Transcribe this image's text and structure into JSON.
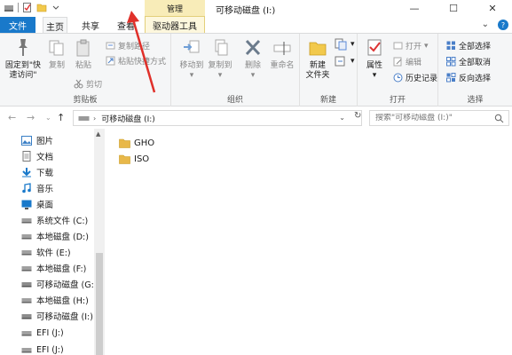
{
  "titlebar": {
    "context_group": "管理",
    "window_title": "可移动磁盘 (I:)",
    "controls": {
      "minimize": "—",
      "maximize": "☐",
      "close": "✕"
    }
  },
  "tabs": {
    "file": "文件",
    "home": "主页",
    "share": "共享",
    "view": "查看",
    "drive_tools": "驱动器工具",
    "expand_icon": "chevron-down-icon",
    "help_icon": "help-icon"
  },
  "ribbon": {
    "clipboard": {
      "label": "剪贴板",
      "pin": "固定到\"快\n速访问\"",
      "copy": "复制",
      "paste": "粘贴",
      "copy_path": "复制路径",
      "paste_shortcut": "粘贴快捷方式",
      "cut": "剪切"
    },
    "organize": {
      "label": "组织",
      "move_to": "移动到",
      "copy_to": "复制到",
      "delete": "删除",
      "rename": "重命名"
    },
    "new": {
      "label": "新建",
      "new_folder": "新建\n文件夹"
    },
    "open": {
      "label": "打开",
      "properties": "属性",
      "open": "打开",
      "edit": "编辑",
      "history": "历史记录"
    },
    "select": {
      "label": "选择",
      "select_all": "全部选择",
      "select_none": "全部取消",
      "invert": "反向选择"
    }
  },
  "address": {
    "path": "可移动磁盘 (I:)",
    "search_placeholder": "搜索\"可移动磁盘 (I:)\""
  },
  "nav": [
    {
      "label": "图片",
      "icon": "pictures-icon"
    },
    {
      "label": "文档",
      "icon": "documents-icon"
    },
    {
      "label": "下载",
      "icon": "downloads-icon"
    },
    {
      "label": "音乐",
      "icon": "music-icon"
    },
    {
      "label": "桌面",
      "icon": "desktop-icon"
    },
    {
      "label": "系统文件 (C:)",
      "icon": "drive-icon"
    },
    {
      "label": "本地磁盘 (D:)",
      "icon": "drive-icon"
    },
    {
      "label": "软件 (E:)",
      "icon": "drive-icon"
    },
    {
      "label": "本地磁盘 (F:)",
      "icon": "drive-icon"
    },
    {
      "label": "可移动磁盘 (G:)",
      "icon": "usb-drive-icon"
    },
    {
      "label": "本地磁盘 (H:)",
      "icon": "drive-icon"
    },
    {
      "label": "可移动磁盘 (I:)",
      "icon": "usb-drive-icon"
    },
    {
      "label": "EFI (J:)",
      "icon": "drive-icon"
    },
    {
      "label": "EFI (J:)",
      "icon": "drive-icon"
    }
  ],
  "files": [
    {
      "name": "GHO",
      "icon": "folder-icon"
    },
    {
      "name": "ISO",
      "icon": "folder-icon"
    }
  ],
  "colors": {
    "file_tab": "#1979ca",
    "context_tab": "#f8ecb8",
    "folder": "#e8b84a",
    "annotation_arrow": "#e0302a"
  }
}
